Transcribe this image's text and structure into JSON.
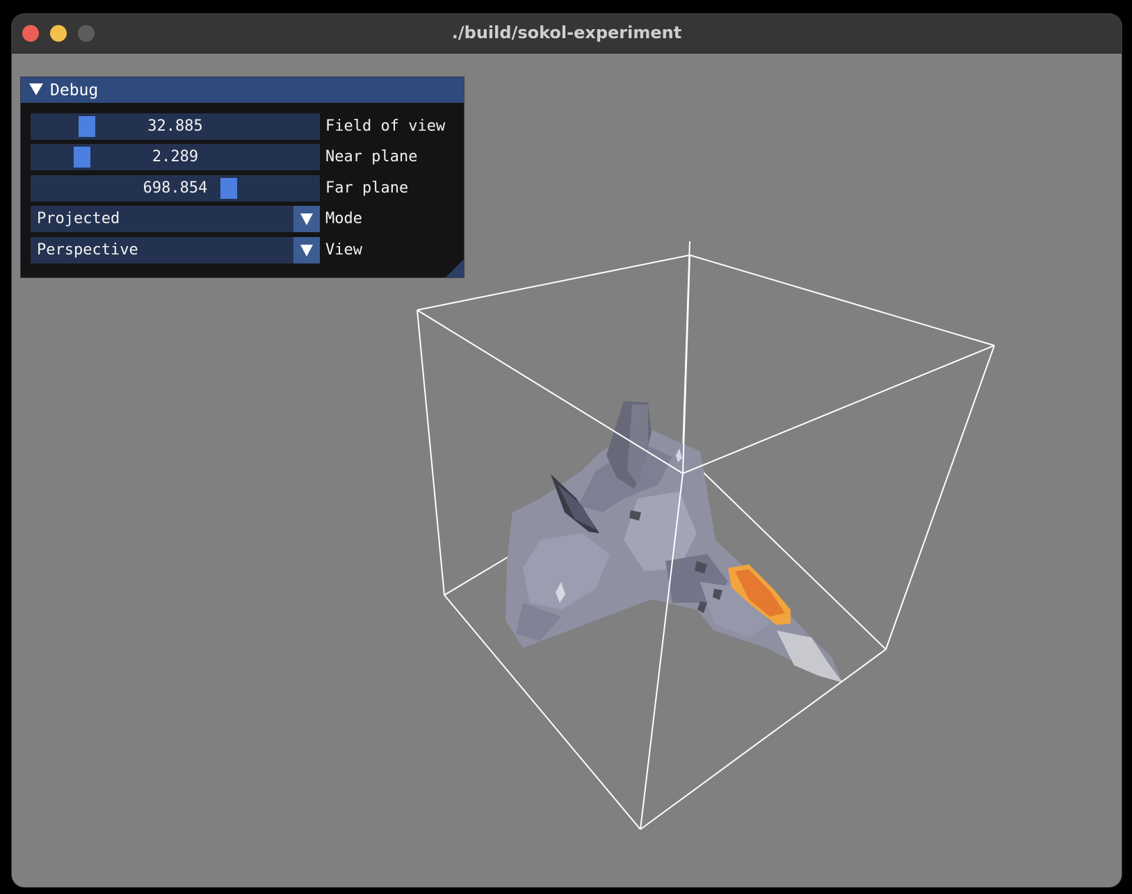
{
  "window": {
    "title": "./build/sokol-experiment"
  },
  "panel": {
    "title": "Debug",
    "sliders": [
      {
        "value": "32.885",
        "label": "Field of view",
        "fraction": 0.17
      },
      {
        "value": "2.289",
        "label": "Near plane",
        "fraction": 0.15
      },
      {
        "value": "698.854",
        "label": "Far plane",
        "fraction": 0.7
      }
    ],
    "combos": [
      {
        "value": "Projected",
        "label": "Mode"
      },
      {
        "value": "Perspective",
        "label": "View"
      }
    ]
  },
  "scene": {
    "background_color": "#808080",
    "bounding_box_color": "#ffffff",
    "accent_color": "#4d7fe0",
    "model": "jet-fighter"
  }
}
